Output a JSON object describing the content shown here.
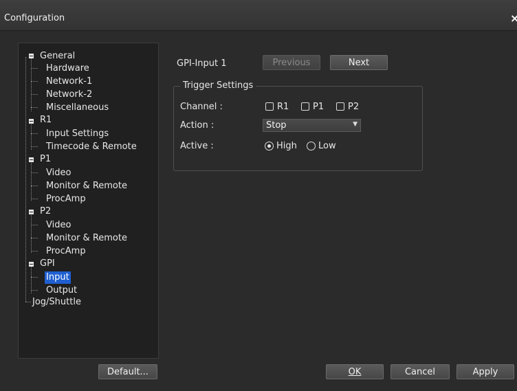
{
  "window": {
    "title": "Configuration",
    "close": "×"
  },
  "tree": {
    "general": "General",
    "hardware": "Hardware",
    "network1": "Network-1",
    "network2": "Network-2",
    "misc": "Miscellaneous",
    "r1": "R1",
    "r1_input": "Input Settings",
    "r1_timecode": "Timecode & Remote",
    "p1": "P1",
    "p1_video": "Video",
    "p1_monitor": "Monitor & Remote",
    "p1_procamp": "ProcAmp",
    "p2": "P2",
    "p2_video": "Video",
    "p2_monitor": "Monitor & Remote",
    "p2_procamp": "ProcAmp",
    "gpi": "GPI",
    "gpi_input": "Input",
    "gpi_output": "Output",
    "jog": "Jog/Shuttle"
  },
  "panel": {
    "gpi_input_label": "GPI-Input 1",
    "previous": "Previous",
    "next": "Next",
    "trigger_settings": "Trigger Settings",
    "channel_label": "Channel :",
    "channels": [
      "R1",
      "P1",
      "P2"
    ],
    "action_label": "Action :",
    "action_value": "Stop",
    "active_label": "Active :",
    "active_high": "High",
    "active_low": "Low"
  },
  "footer": {
    "default": "Default...",
    "ok": "OK",
    "cancel": "Cancel",
    "apply": "Apply"
  }
}
